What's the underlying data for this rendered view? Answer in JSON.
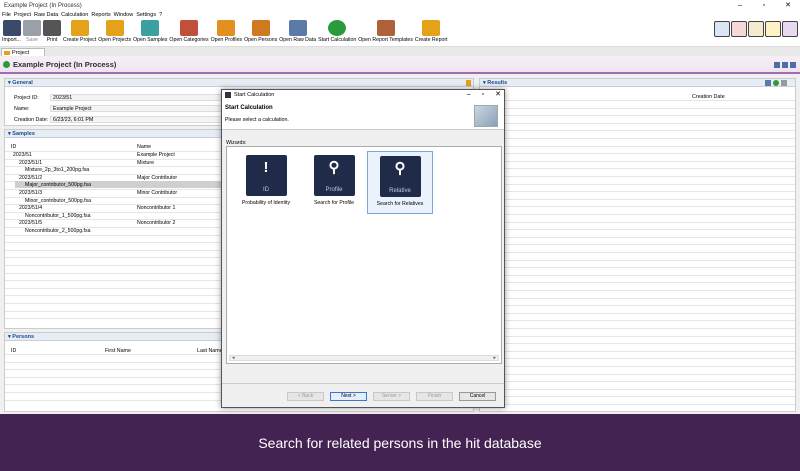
{
  "window": {
    "title": "Example Project (In Process)"
  },
  "menu": [
    "File",
    "Project",
    "Raw Data",
    "Calculation",
    "Reports",
    "Window",
    "Settings",
    "?"
  ],
  "toolbar": [
    {
      "label": "Import...",
      "icon": "import-icon",
      "dim": false
    },
    {
      "label": "Save",
      "icon": "save-icon",
      "dim": true
    },
    {
      "label": "Print",
      "icon": "print-icon",
      "dim": false
    },
    {
      "label": "Create Project",
      "icon": "create-project-icon",
      "dim": false
    },
    {
      "label": "Open Projects",
      "icon": "open-projects-icon",
      "dim": false
    },
    {
      "label": "Open Samples",
      "icon": "open-samples-icon",
      "dim": false
    },
    {
      "label": "Open Categories",
      "icon": "open-categories-icon",
      "dim": false
    },
    {
      "label": "Open Profiles",
      "icon": "open-profiles-icon",
      "dim": false
    },
    {
      "label": "Open Persons",
      "icon": "open-persons-icon",
      "dim": false
    },
    {
      "label": "Open Raw Data",
      "icon": "open-raw-data-icon",
      "dim": false
    },
    {
      "label": "Start Calculation",
      "icon": "start-calculation-icon",
      "dim": false
    },
    {
      "label": "Open Report Templates",
      "icon": "open-report-templates-icon",
      "dim": false
    },
    {
      "label": "Create Report",
      "icon": "create-report-icon",
      "dim": false
    }
  ],
  "tab": {
    "label": "Project"
  },
  "project_header": {
    "title": "Example Project (In Process)"
  },
  "general": {
    "heading": "General",
    "fields": [
      {
        "label": "Project ID:",
        "value": "2023/51"
      },
      {
        "label": "Name:",
        "value": "Example Project"
      },
      {
        "label": "Creation Date:",
        "value": "6/23/23, 6:01 PM"
      }
    ]
  },
  "samples": {
    "heading": "Samples",
    "columns": [
      "ID",
      "Name"
    ],
    "rows": [
      {
        "id": "2023/51",
        "name": "Example Project"
      },
      {
        "id": "2023/51/1",
        "name": "Mixture"
      },
      {
        "id": "Mixture_2p_3to1_200pg.fsa",
        "name": ""
      },
      {
        "id": "2023/51/2",
        "name": "Major Contributor"
      },
      {
        "id": "Major_contributor_500pg.fsa",
        "name": ""
      },
      {
        "id": "2023/51/3",
        "name": "Minor Contributor"
      },
      {
        "id": "Minor_contributor_500pg.fsa",
        "name": ""
      },
      {
        "id": "2023/51/4",
        "name": "Noncontributor 1"
      },
      {
        "id": "Noncontributor_1_500pg.fsa",
        "name": ""
      },
      {
        "id": "2023/51/5",
        "name": "Noncontributor 2"
      },
      {
        "id": "Noncontributor_2_500pg.fsa",
        "name": ""
      }
    ]
  },
  "persons": {
    "heading": "Persons",
    "columns": [
      "ID",
      "First Name",
      "Last Name"
    ]
  },
  "results": {
    "heading": "Results",
    "columns": [
      "Creation Date"
    ]
  },
  "dialog": {
    "title": "Start Calculation",
    "heading": "Start Calculation",
    "subheading": "Please select a calculation.",
    "wizards_label": "Wizards:",
    "wizards": [
      {
        "label": "Probability of Identity",
        "badge": "ID",
        "selected": false
      },
      {
        "label": "Search for Profile",
        "badge": "Profile",
        "selected": false
      },
      {
        "label": "Search for Relatives",
        "badge": "Relative",
        "selected": true
      }
    ],
    "buttons": {
      "back": "< Back",
      "next": "Next >",
      "server": "Server >",
      "finish": "Finish",
      "cancel": "Cancel"
    }
  },
  "caption": "Search for related persons in the hit database"
}
